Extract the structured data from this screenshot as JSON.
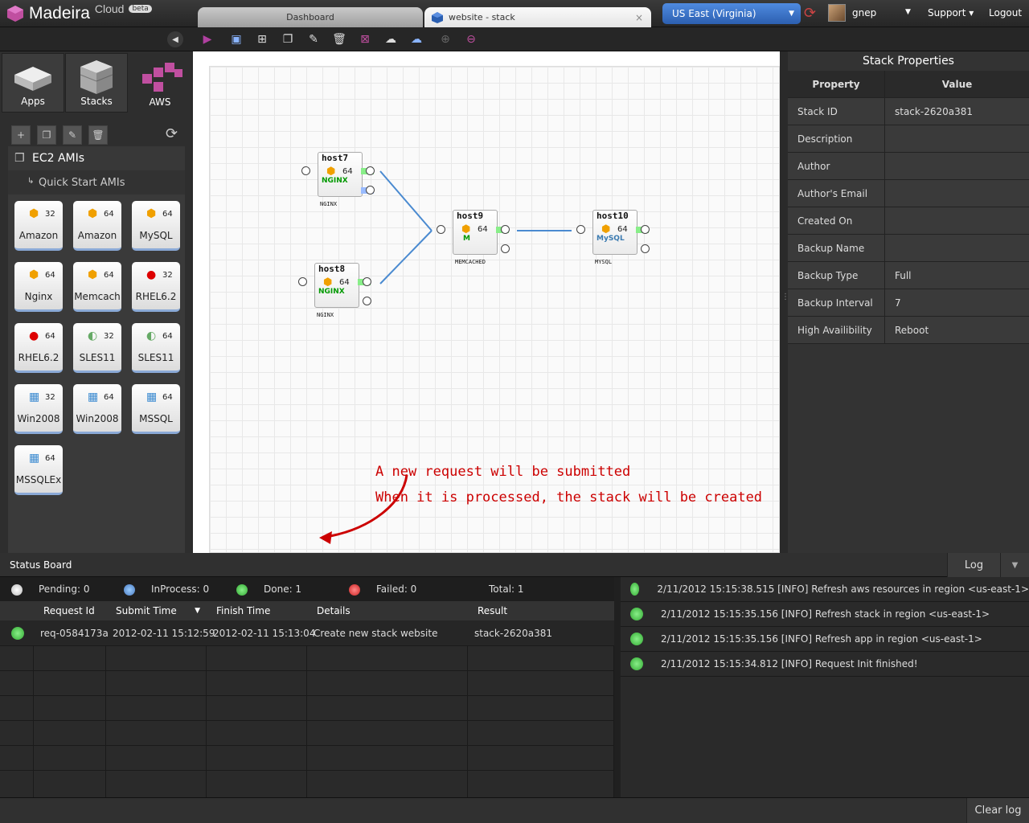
{
  "header": {
    "brand": "Madeira",
    "brand_suffix": "Cloud",
    "badge": "beta",
    "tabs": [
      {
        "label": "Dashboard"
      },
      {
        "label": "website - stack"
      }
    ],
    "tab_close": "×",
    "region": "US East (Virginia)",
    "user": "gnep",
    "support": "Support",
    "logout": "Logout"
  },
  "toolbar_icons": [
    "collapse-icon",
    "run-icon",
    "save-icon",
    "duplicate-icon",
    "copy-icon",
    "edit-icon",
    "delete-icon",
    "export-png-icon",
    "upload-cloud-icon",
    "download-cloud-icon",
    "zoom-in-icon",
    "zoom-out-icon"
  ],
  "library": {
    "tabs": [
      {
        "label": "Apps",
        "active": false
      },
      {
        "label": "Stacks",
        "active": false
      },
      {
        "label": "AWS",
        "active": true
      }
    ],
    "section": "EC2 AMIs",
    "subsection": "Quick Start AMIs",
    "amis": [
      {
        "name": "Amazon",
        "bits": "32",
        "icon": "amazon-cube-icon"
      },
      {
        "name": "Amazon",
        "bits": "64",
        "icon": "amazon-cube-icon"
      },
      {
        "name": "MySQL",
        "bits": "64",
        "icon": "mysql-icon"
      },
      {
        "name": "Nginx",
        "bits": "64",
        "icon": "nginx-icon"
      },
      {
        "name": "Memcach",
        "bits": "64",
        "icon": "memcached-icon"
      },
      {
        "name": "RHEL6.2",
        "bits": "32",
        "icon": "redhat-icon"
      },
      {
        "name": "RHEL6.2",
        "bits": "64",
        "icon": "redhat-icon"
      },
      {
        "name": "SLES11",
        "bits": "32",
        "icon": "suse-icon"
      },
      {
        "name": "SLES11",
        "bits": "64",
        "icon": "suse-icon"
      },
      {
        "name": "Win2008",
        "bits": "32",
        "icon": "windows-icon"
      },
      {
        "name": "Win2008",
        "bits": "64",
        "icon": "windows-icon"
      },
      {
        "name": "MSSQL",
        "bits": "64",
        "icon": "windows-icon"
      },
      {
        "name": "MSSQLEx",
        "bits": "64",
        "icon": "windows-icon"
      }
    ]
  },
  "canvas": {
    "nodes": [
      {
        "name": "host7",
        "bits": "64",
        "brand": "NGINX",
        "sub": "NGINX"
      },
      {
        "name": "host8",
        "bits": "64",
        "brand": "NGINX",
        "sub": "NGINX"
      },
      {
        "name": "host9",
        "bits": "64",
        "brand": "M",
        "sub": "MEMCACHED"
      },
      {
        "name": "host10",
        "bits": "64",
        "brand": "MySQL",
        "sub": "MYSQL"
      }
    ],
    "annotation_line1": "A new request will be submitted",
    "annotation_line2": "When it is processed, the stack will be created",
    "annotation_color": "#cc0000"
  },
  "properties": {
    "title": "Stack Properties",
    "col_property": "Property",
    "col_value": "Value",
    "rows": [
      {
        "k": "Stack ID",
        "v": "stack-2620a381"
      },
      {
        "k": "Description",
        "v": ""
      },
      {
        "k": "Author",
        "v": ""
      },
      {
        "k": "Author's Email",
        "v": ""
      },
      {
        "k": "Created On",
        "v": ""
      },
      {
        "k": "Backup Name",
        "v": ""
      },
      {
        "k": "Backup Type",
        "v": "Full"
      },
      {
        "k": "Backup Interval",
        "v": "7"
      },
      {
        "k": "High Availibility",
        "v": "Reboot"
      }
    ]
  },
  "status": {
    "title": "Status Board",
    "log_button": "Log",
    "counts": {
      "pending": "Pending: 0",
      "inprocess": "InProcess: 0",
      "done": "Done: 1",
      "failed": "Failed: 0",
      "total": "Total: 1"
    },
    "columns": [
      "Request Id",
      "Submit Time",
      "Finish Time",
      "Details",
      "Result"
    ],
    "rows": [
      {
        "id": "req-0584173a",
        "submit": "2012-02-11 15:12:59",
        "finish": "2012-02-11 15:13:04",
        "details": "Create new stack website",
        "result": "stack-2620a381",
        "state": "done"
      }
    ],
    "clear_log": "Clear log"
  },
  "log": [
    "2/11/2012 15:15:38.515 [INFO] Refresh aws resources in region <us-east-1>",
    "2/11/2012 15:15:35.156 [INFO] Refresh stack in region <us-east-1>",
    "2/11/2012 15:15:35.156 [INFO] Refresh app in region <us-east-1>",
    "2/11/2012 15:15:34.812 [INFO] Request Init finished!"
  ],
  "colors": {
    "brand_accent": "#c04fa0",
    "region_blue": "#3a70c8",
    "status_done": "#3aa83a",
    "status_failed": "#d03030",
    "status_inprocess": "#5a8fd0"
  }
}
